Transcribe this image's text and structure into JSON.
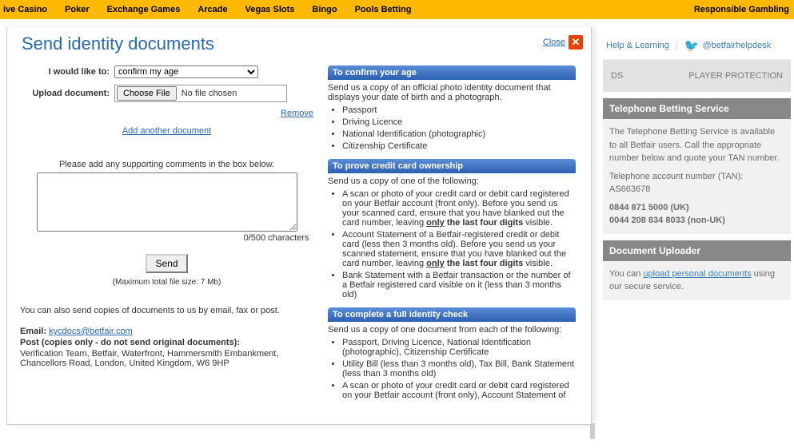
{
  "nav": {
    "items": [
      "ive Casino",
      "Poker",
      "Exchange Games",
      "Arcade",
      "Vegas Slots",
      "Bingo",
      "Pools Betting"
    ],
    "rg": "Responsible Gambling"
  },
  "modal": {
    "title": "Send identity documents",
    "close": "Close",
    "form": {
      "liketo_label": "I would like to:",
      "liketo_value": "confirm my age",
      "upload_label": "Upload document:",
      "choose": "Choose File",
      "nofile": "No file chosen",
      "remove": "Remove",
      "add": "Add another document",
      "comments_label": "Please add any supporting comments in the box below.",
      "counter": "0/500 characters",
      "send": "Send",
      "maxsize": "(Maximum total file size:  7 Mb)"
    },
    "post": {
      "intro": "You can also send copies of documents to us by email, fax or post.",
      "email_lbl": "Email:",
      "email": "kycdocs@betfair.com",
      "post_lbl": "Post (copies only - do not send original documents):",
      "addr": "Verification Team, Betfair, Waterfront, Hammersmith Embankment, Chancellors Road, London, United Kingdom, W6 9HP"
    },
    "panels": {
      "age": {
        "h": "To confirm your age",
        "intro": "Send us a copy of an official photo identity document that displays your date of birth and a photograph.",
        "items": [
          "Passport",
          "Driving Licence",
          "National Identification (photographic)",
          "Citizenship Certificate"
        ]
      },
      "cc": {
        "h": "To prove credit card ownership",
        "intro": "Send us a copy of one of the following:",
        "i1a": "A scan or photo of your credit card or debit card registered on your Betfair account (front only). Before you send us your scanned card, ensure that you have blanked out the card number, leaving ",
        "i1b": "only",
        "i1c": " the last four digits",
        "i1d": " visible.",
        "i2a": "Account Statement of a Betfair-registered credit or debit card (less then 3 months old). Before you send us your scanned statement, ensure that you have blanked out the card number, leaving ",
        "i2b": "only",
        "i2c": " the last four digits",
        "i2d": " visible.",
        "i3": "Bank Statement with a Betfair transaction or the number of a Betfair registered card visible on it (less than 3 months old)"
      },
      "full": {
        "h": "To complete a full identity check",
        "intro": "Send us a copy of one document from each of the following:",
        "items": [
          "Passport, Driving Licence, National Identification (photographic), Citizenship Certificate",
          "Utility Bill (less than 3 months old), Tax Bill, Bank Statement (less than 3 months old)",
          "A scan or photo of your credit card or debit card registered on your Betfair account (front only), Account Statement of"
        ]
      }
    }
  },
  "side": {
    "help": "Help & Learning",
    "tw": "@betfairhelpdesk",
    "tabs": [
      "DS",
      "PLAYER PROTECTION"
    ],
    "tbs": {
      "h": "Telephone Betting Service",
      "p1": "The Telephone Betting Service is available to all Betfair users. Call the appropriate number below and quote your TAN number.",
      "p2": "Telephone account number (TAN):",
      "tan": "AS663678",
      "uk": "0844 871 5000 (UK)",
      "nonuk": "0044 208 834 8033 (non-UK)"
    },
    "du": {
      "h": "Document Uploader",
      "p1a": "You can ",
      "link": "upload personal documents",
      "p1b": " using our secure service."
    }
  }
}
